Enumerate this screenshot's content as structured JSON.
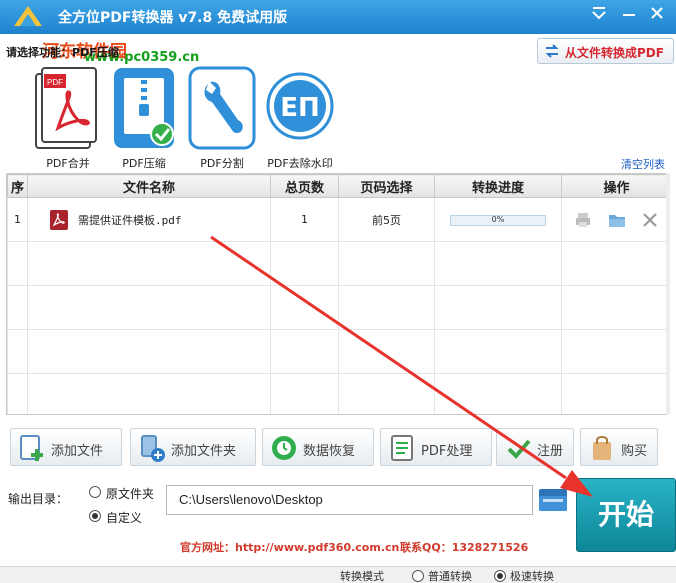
{
  "window": {
    "title": "全方位PDF转换器 v7.8 免费试用版",
    "menu_icon": "chevron-down-icon",
    "close_icon": "close-icon"
  },
  "watermark": {
    "site_name": "河东软件园",
    "url": "www.pc0359.cn"
  },
  "toolbar": {
    "hint": "请选择功能：PDF压缩",
    "convert_from_file_label": "从文件转换成PDF"
  },
  "tools": [
    {
      "label": "PDF合并",
      "icon": "pdf-merge-icon",
      "icon_text": "PDF"
    },
    {
      "label": "PDF压缩",
      "icon": "pdf-compress-icon",
      "selected": true
    },
    {
      "label": "PDF分割",
      "icon": "pdf-split-icon"
    },
    {
      "label": "PDF去除水印",
      "icon": "pdf-remove-watermark-icon",
      "icon_text": "EП"
    }
  ],
  "clear_list_label": "清空列表",
  "table": {
    "headers": [
      "序",
      "文件名称",
      "总页数",
      "页码选择",
      "转换进度",
      "操作"
    ],
    "rows": [
      {
        "index": "1",
        "filename": "需提供证件模板.pdf",
        "pages": "1",
        "page_selection": "前5页",
        "progress": 0,
        "progress_text": "0%"
      }
    ]
  },
  "actions": [
    {
      "label": "添加文件",
      "icon": "add-file-icon"
    },
    {
      "label": "添加文件夹",
      "icon": "add-folder-icon"
    },
    {
      "label": "数据恢复",
      "icon": "data-recovery-icon"
    },
    {
      "label": "PDF处理",
      "icon": "pdf-process-icon"
    },
    {
      "label": "注册",
      "icon": "register-icon"
    },
    {
      "label": "购买",
      "icon": "buy-icon"
    }
  ],
  "output": {
    "label": "输出目录：",
    "option_original": "原文件夹",
    "option_custom": "自定义",
    "selected": "custom",
    "path": "C:\\Users\\lenovo\\Desktop"
  },
  "start_label": "开始",
  "footer": {
    "website": "官方网址：http://www.pdf360.com.cn",
    "contact": "联系QQ：1328271526"
  },
  "bottom_strip": {
    "mode_label": "转换模式",
    "option_a": "普通转换",
    "option_b": "极速转换"
  },
  "colors": {
    "titlebar": "#1f82cf",
    "accent_red": "#d7262f",
    "start": "#1a9fb1",
    "arrow": "#e8322c"
  }
}
